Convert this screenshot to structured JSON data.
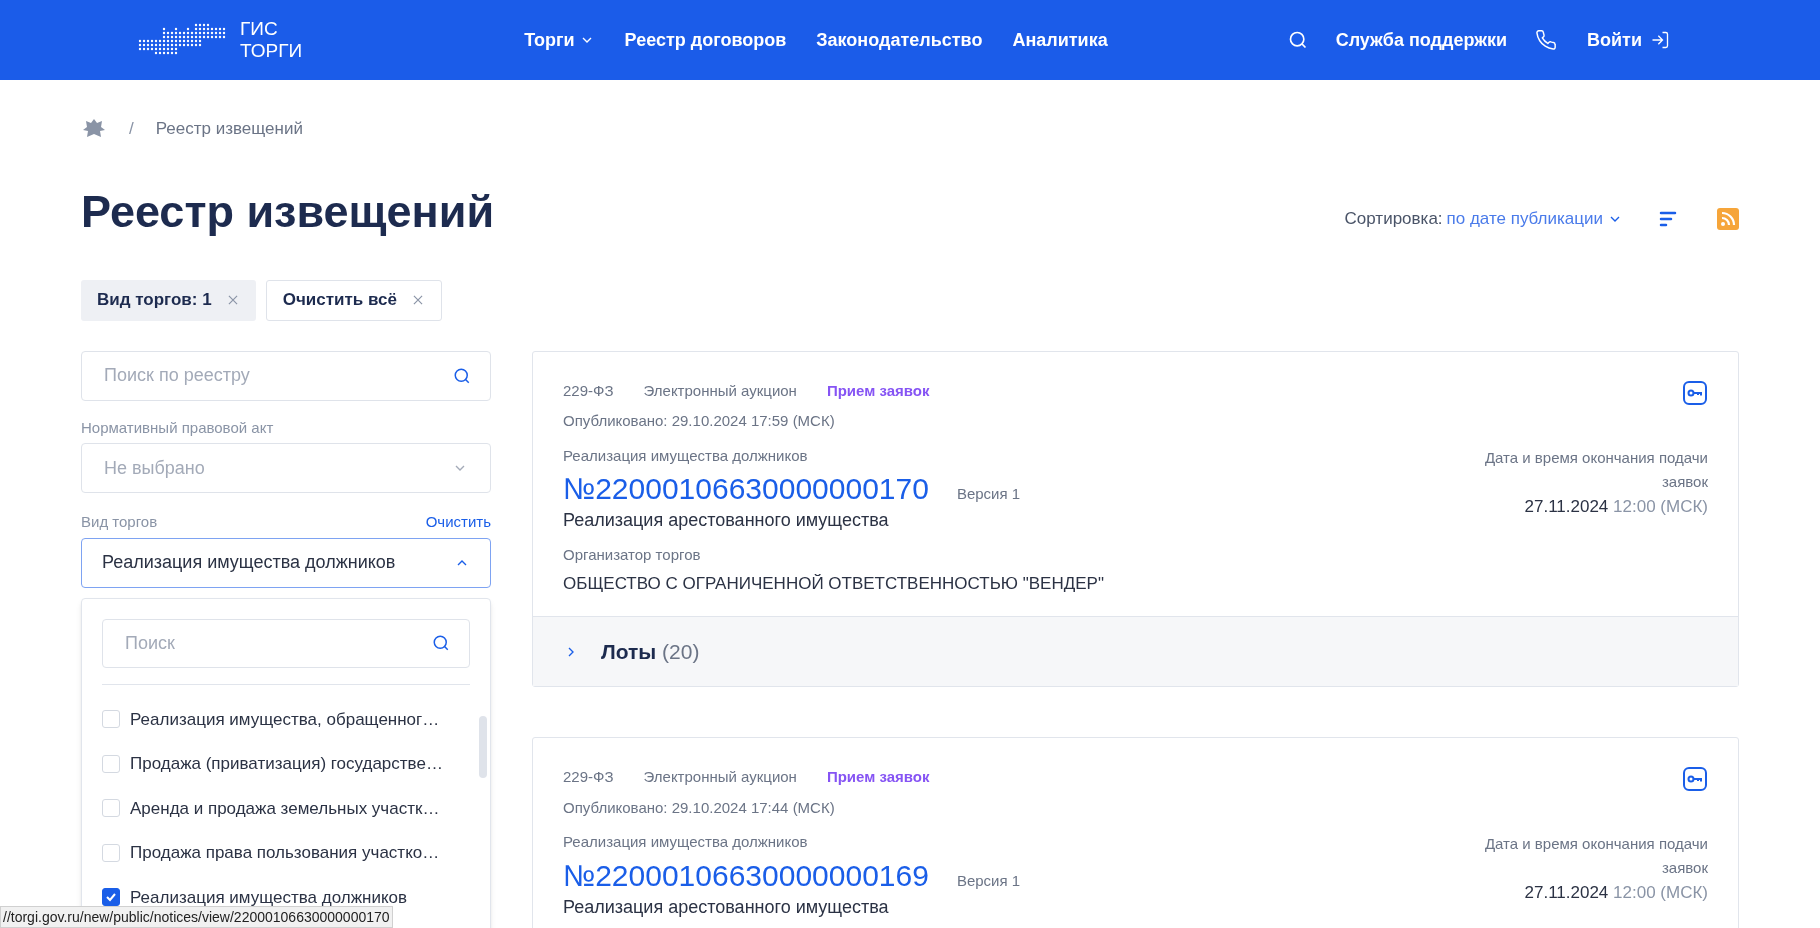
{
  "header": {
    "logo_lines": [
      "ГИС",
      "ТОРГИ"
    ],
    "nav": [
      {
        "label": "Торги",
        "dropdown": true
      },
      {
        "label": "Реестр договоров",
        "dropdown": false
      },
      {
        "label": "Законодательство",
        "dropdown": false
      },
      {
        "label": "Аналитика",
        "dropdown": false
      }
    ],
    "support": "Служба поддержки",
    "login": "Войти"
  },
  "breadcrumb": {
    "separator": "/",
    "items": [
      "Реестр извещений"
    ]
  },
  "title": "Реестр извещений",
  "sort": {
    "label": "Сортировка:",
    "value": "по дате публикации"
  },
  "chips": [
    {
      "label": "Вид торгов: 1",
      "kind": "filter"
    },
    {
      "label": "Очистить всё",
      "kind": "clear"
    }
  ],
  "filters": {
    "search_placeholder": "Поиск по реестру",
    "npa": {
      "label": "Нормативный правовой акт",
      "placeholder": "Не выбрано"
    },
    "type": {
      "label": "Вид торгов",
      "clear": "Очистить",
      "value": "Реализация имущества должников",
      "expanded": true,
      "search_placeholder": "Поиск",
      "options": [
        {
          "label": "Реализация имущества, обращенног…",
          "checked": false
        },
        {
          "label": "Продажа (приватизация) государстве…",
          "checked": false
        },
        {
          "label": "Аренда и продажа земельных участк…",
          "checked": false
        },
        {
          "label": "Продажа права пользования участко…",
          "checked": false
        },
        {
          "label": "Реализация имущества должников",
          "checked": true
        }
      ]
    }
  },
  "notices": [
    {
      "law": "229-ФЗ",
      "method": "Электронный аукцион",
      "status": "Прием заявок",
      "published": "Опубликовано: 29.10.2024 17:59 (МСК)",
      "category": "Реализация имущества должников",
      "number": "№22000106630000000170",
      "version": "Версия 1",
      "subject": "Реализация арестованного имущества",
      "organizer_label": "Организатор торгов",
      "organizer": "ОБЩЕСТВО С ОГРАНИЧЕННОЙ ОТВЕТСТВЕННОСТЬЮ \"ВЕНДЕР\"",
      "deadline_label": "Дата и время окончания подачи заявок",
      "deadline_date": "27.11.2024",
      "deadline_time": "12:00 (МСК)",
      "lots": {
        "label": "Лоты",
        "count": "(20)",
        "expanded": false
      }
    },
    {
      "law": "229-ФЗ",
      "method": "Электронный аукцион",
      "status": "Прием заявок",
      "published": "Опубликовано: 29.10.2024 17:44 (МСК)",
      "category": "Реализация имущества должников",
      "number": "№22000106630000000169",
      "version": "Версия 1",
      "subject": "Реализация арестованного имущества",
      "deadline_label": "Дата и время окончания подачи заявок",
      "deadline_date": "27.11.2024",
      "deadline_time": "12:00 (МСК)"
    }
  ],
  "status_bar": "//torgi.gov.ru/new/public/notices/view/22000106630000000170"
}
